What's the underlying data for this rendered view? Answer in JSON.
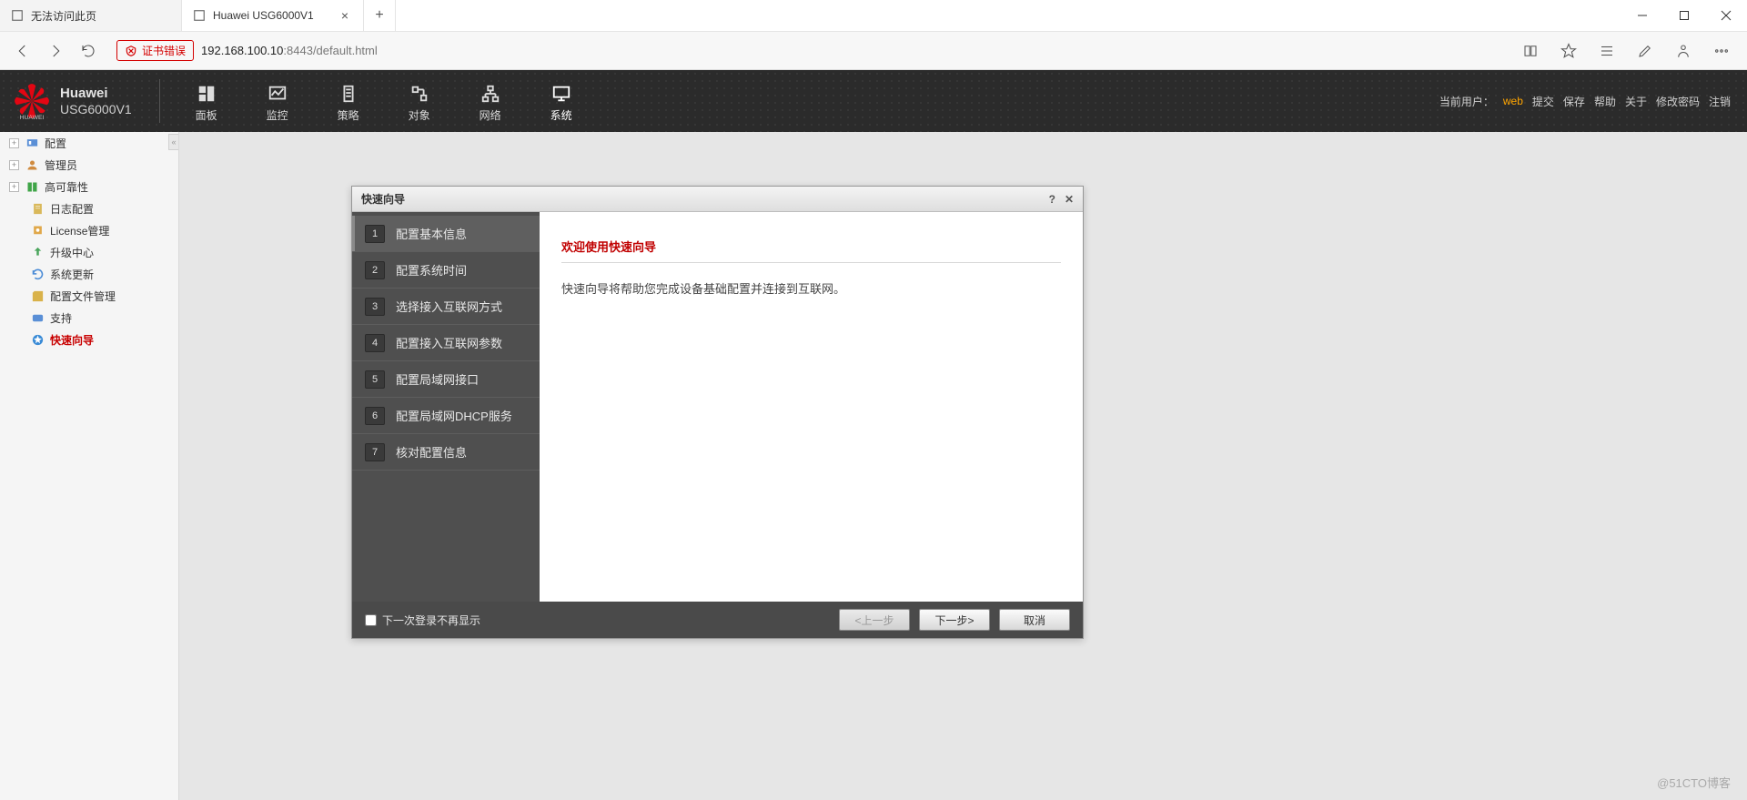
{
  "browser": {
    "tabs": [
      {
        "label": "无法访问此页",
        "active": false
      },
      {
        "label": "Huawei USG6000V1",
        "active": true
      }
    ],
    "cert_error": "证书错误",
    "url_host": "192.168.100.10",
    "url_port": ":8443",
    "url_path": "/default.html"
  },
  "header": {
    "brand": "Huawei",
    "model": "USG6000V1",
    "nav": [
      {
        "label": "面板",
        "icon": "dashboard-icon"
      },
      {
        "label": "监控",
        "icon": "monitor-icon"
      },
      {
        "label": "策略",
        "icon": "policy-icon"
      },
      {
        "label": "对象",
        "icon": "object-icon"
      },
      {
        "label": "网络",
        "icon": "network-icon"
      },
      {
        "label": "系统",
        "icon": "system-icon",
        "active": true
      }
    ],
    "cur_user_label": "当前用户：",
    "cur_user": "web",
    "links": {
      "submit": "提交",
      "save": "保存",
      "help": "帮助",
      "about": "关于",
      "chpwd": "修改密码",
      "logout": "注销"
    }
  },
  "sidebar": {
    "items": [
      {
        "label": "配置",
        "expandable": true,
        "level": 1,
        "icon": "config-icon"
      },
      {
        "label": "管理员",
        "expandable": true,
        "level": 1,
        "icon": "admin-icon"
      },
      {
        "label": "高可靠性",
        "expandable": true,
        "level": 1,
        "icon": "ha-icon"
      },
      {
        "label": "日志配置",
        "expandable": false,
        "level": 2,
        "icon": "log-icon"
      },
      {
        "label": "License管理",
        "expandable": false,
        "level": 2,
        "icon": "license-icon"
      },
      {
        "label": "升级中心",
        "expandable": false,
        "level": 2,
        "icon": "upgrade-icon"
      },
      {
        "label": "系统更新",
        "expandable": false,
        "level": 2,
        "icon": "update-icon"
      },
      {
        "label": "配置文件管理",
        "expandable": false,
        "level": 2,
        "icon": "cfgfile-icon"
      },
      {
        "label": "支持",
        "expandable": false,
        "level": 2,
        "icon": "support-icon"
      },
      {
        "label": "快速向导",
        "expandable": false,
        "level": 2,
        "icon": "wizard-icon",
        "active": true
      }
    ]
  },
  "wizard": {
    "title": "快速向导",
    "steps": [
      {
        "n": "1",
        "label": "配置基本信息",
        "active": true
      },
      {
        "n": "2",
        "label": "配置系统时间"
      },
      {
        "n": "3",
        "label": "选择接入互联网方式"
      },
      {
        "n": "4",
        "label": "配置接入互联网参数"
      },
      {
        "n": "5",
        "label": "配置局域网接口"
      },
      {
        "n": "6",
        "label": "配置局域网DHCP服务"
      },
      {
        "n": "7",
        "label": "核对配置信息"
      }
    ],
    "welcome": "欢迎使用快速向导",
    "desc": "快速向导将帮助您完成设备基础配置并连接到互联网。",
    "dont_show": "下一次登录不再显示",
    "btn_prev": "<上一步",
    "btn_next": "下一步>",
    "btn_cancel": "取消"
  },
  "watermark": "@51CTO博客"
}
